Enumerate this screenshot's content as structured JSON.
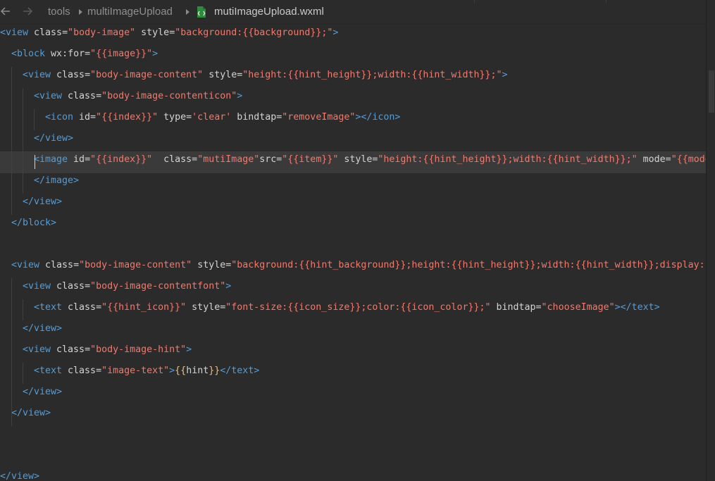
{
  "breadcrumb": {
    "items": [
      "tools",
      "multiImageUpload",
      "mutiImageUpload.wxml"
    ]
  },
  "code": {
    "lines": [
      [
        [
          "b",
          "<view"
        ],
        [
          "a",
          " class="
        ],
        [
          "s",
          "\"body-image\""
        ],
        [
          "a",
          " style="
        ],
        [
          "s",
          "\"background:{{background}};\""
        ],
        [
          "b",
          ">"
        ]
      ],
      [
        [
          "b",
          "<block"
        ],
        [
          "a",
          " wx:for="
        ],
        [
          "s",
          "\"{{image}}\""
        ],
        [
          "b",
          ">"
        ]
      ],
      [
        [
          "b",
          "<view"
        ],
        [
          "a",
          " class="
        ],
        [
          "s",
          "\"body-image-content\""
        ],
        [
          "a",
          " style="
        ],
        [
          "s",
          "\"height:{{hint_height}};width:{{hint_width}};\""
        ],
        [
          "b",
          ">"
        ]
      ],
      [
        [
          "b",
          "<view"
        ],
        [
          "a",
          " class="
        ],
        [
          "s",
          "\"body-image-contenticon\""
        ],
        [
          "b",
          ">"
        ]
      ],
      [
        [
          "b",
          "<icon"
        ],
        [
          "a",
          " id="
        ],
        [
          "s",
          "\"{{index}}\""
        ],
        [
          "a",
          " type="
        ],
        [
          "s",
          "'clear'"
        ],
        [
          "a",
          " bindtap="
        ],
        [
          "s",
          "\"removeImage\""
        ],
        [
          "b",
          "></icon>"
        ]
      ],
      [
        [
          "b",
          "</view>"
        ]
      ],
      [
        [
          "b",
          "<image"
        ],
        [
          "a",
          " id="
        ],
        [
          "s",
          "\"{{index}}\""
        ],
        [
          "a",
          "  class="
        ],
        [
          "s",
          "\"mutiImage\""
        ],
        [
          "a",
          "src="
        ],
        [
          "s",
          "\"{{item}}\""
        ],
        [
          "a",
          " style="
        ],
        [
          "s",
          "\"height:{{hint_height}};width:{{hint_width}};\""
        ],
        [
          "a",
          " mode="
        ],
        [
          "s",
          "\"{{mode}}\""
        ]
      ],
      [
        [
          "b",
          "</image>"
        ]
      ],
      [
        [
          "b",
          "</view>"
        ]
      ],
      [
        [
          "b",
          "</block>"
        ]
      ],
      [],
      [
        [
          "b",
          "<view"
        ],
        [
          "a",
          " class="
        ],
        [
          "s",
          "\"body-image-content\""
        ],
        [
          "a",
          " style="
        ],
        [
          "s",
          "\"background:{{hint_background}};height:{{hint_height}};width:{{hint_width}};display:flex\""
        ]
      ],
      [
        [
          "b",
          "<view"
        ],
        [
          "a",
          " class="
        ],
        [
          "s",
          "\"body-image-contentfont\""
        ],
        [
          "b",
          ">"
        ]
      ],
      [
        [
          "b",
          "<text"
        ],
        [
          "a",
          " class="
        ],
        [
          "s",
          "\"{{hint_icon}}\""
        ],
        [
          "a",
          " style="
        ],
        [
          "s",
          "\"font-size:{{icon_size}};color:{{icon_color}};\""
        ],
        [
          "a",
          " bindtap="
        ],
        [
          "s",
          "\"chooseImage\""
        ],
        [
          "b",
          "></text>"
        ]
      ],
      [
        [
          "b",
          "</view>"
        ]
      ],
      [
        [
          "b",
          "<view"
        ],
        [
          "a",
          " class="
        ],
        [
          "s",
          "\"body-image-hint\""
        ],
        [
          "b",
          ">"
        ]
      ],
      [
        [
          "b",
          "<text"
        ],
        [
          "a",
          " class="
        ],
        [
          "s",
          "\"image-text\""
        ],
        [
          "b",
          ">"
        ],
        [
          "y",
          "{{"
        ],
        [
          "t",
          "hint"
        ],
        [
          "y",
          "}}"
        ],
        [
          "b",
          "</text>"
        ]
      ],
      [
        [
          "b",
          "</view>"
        ]
      ],
      [
        [
          "b",
          "</view>"
        ]
      ],
      [],
      [],
      [
        [
          "b",
          "</view>"
        ]
      ]
    ]
  }
}
